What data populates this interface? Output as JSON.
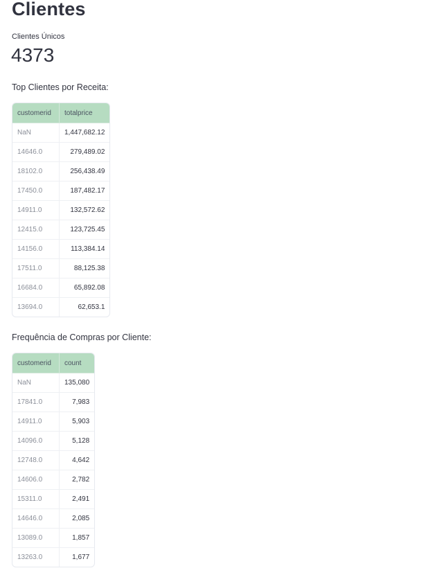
{
  "page": {
    "title": "Clientes"
  },
  "metric": {
    "label": "Clientes Únicos",
    "value": "4373"
  },
  "top_revenue": {
    "label": "Top Clientes por Receita:",
    "columns": [
      "customerid",
      "totalprice"
    ],
    "rows": [
      [
        "NaN",
        "1,447,682.12"
      ],
      [
        "14646.0",
        "279,489.02"
      ],
      [
        "18102.0",
        "256,438.49"
      ],
      [
        "17450.0",
        "187,482.17"
      ],
      [
        "14911.0",
        "132,572.62"
      ],
      [
        "12415.0",
        "123,725.45"
      ],
      [
        "14156.0",
        "113,384.14"
      ],
      [
        "17511.0",
        "88,125.38"
      ],
      [
        "16684.0",
        "65,892.08"
      ],
      [
        "13694.0",
        "62,653.1"
      ]
    ]
  },
  "purchase_frequency": {
    "label": "Frequência de Compras por Cliente:",
    "columns": [
      "customerid",
      "count"
    ],
    "rows": [
      [
        "NaN",
        "135,080"
      ],
      [
        "17841.0",
        "7,983"
      ],
      [
        "14911.0",
        "5,903"
      ],
      [
        "14096.0",
        "5,128"
      ],
      [
        "12748.0",
        "4,642"
      ],
      [
        "14606.0",
        "2,782"
      ],
      [
        "15311.0",
        "2,491"
      ],
      [
        "14646.0",
        "2,085"
      ],
      [
        "13089.0",
        "1,857"
      ],
      [
        "13263.0",
        "1,677"
      ]
    ]
  },
  "colors": {
    "header_bg": "#b6dcc1",
    "text": "#31333f",
    "index_text": "#8b8f99"
  }
}
